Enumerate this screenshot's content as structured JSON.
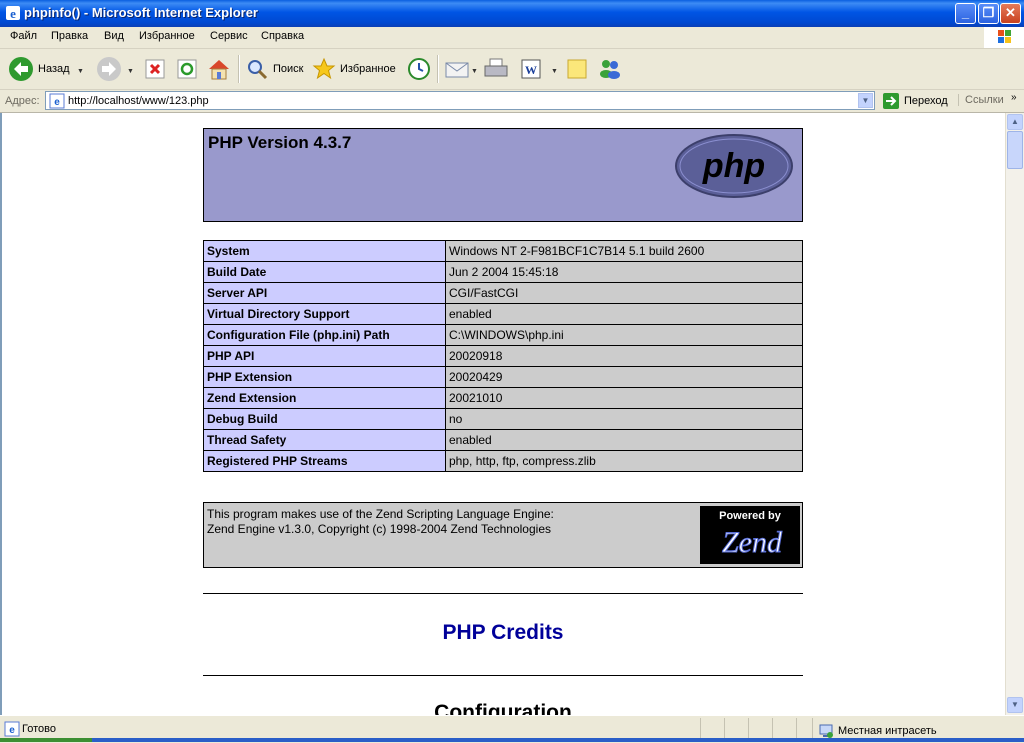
{
  "window": {
    "title": "phpinfo() - Microsoft Internet Explorer"
  },
  "menu": [
    "Файл",
    "Правка",
    "Вид",
    "Избранное",
    "Сервис",
    "Справка"
  ],
  "toolbar": {
    "back_label": "Назад",
    "search_label": "Поиск",
    "favorites_label": "Избранное"
  },
  "address": {
    "label": "Адрес:",
    "url": "http://localhost/www/123.php",
    "go_label": "Переход",
    "links_label": "Ссылки"
  },
  "page": {
    "header_title": "PHP Version 4.3.7",
    "info_rows": [
      {
        "key": "System",
        "value": "Windows NT 2-F981BCF1C7B14 5.1 build 2600"
      },
      {
        "key": "Build Date",
        "value": "Jun 2 2004 15:45:18"
      },
      {
        "key": "Server API",
        "value": "CGI/FastCGI"
      },
      {
        "key": "Virtual Directory Support",
        "value": "enabled"
      },
      {
        "key": "Configuration File (php.ini) Path",
        "value": "C:\\WINDOWS\\php.ini"
      },
      {
        "key": "PHP API",
        "value": "20020918"
      },
      {
        "key": "PHP Extension",
        "value": "20020429"
      },
      {
        "key": "Zend Extension",
        "value": "20021010"
      },
      {
        "key": "Debug Build",
        "value": "no"
      },
      {
        "key": "Thread Safety",
        "value": "enabled"
      },
      {
        "key": "Registered PHP Streams",
        "value": "php, http, ftp, compress.zlib"
      }
    ],
    "zend_line1": "This program makes use of the Zend Scripting Language Engine:",
    "zend_line2": "Zend Engine v1.3.0, Copyright (c) 1998-2004 Zend Technologies",
    "zend_logo_text": "Powered by",
    "zend_logo_word": "Zend",
    "php_logo_text": "php",
    "credits_heading": "PHP Credits",
    "config_heading": "Configuration"
  },
  "status": {
    "text": "Готово",
    "zone": "Местная интрасеть"
  },
  "colors": {
    "header_bg": "#9999cc",
    "key_bg": "#ccccff",
    "value_bg": "#cccccc",
    "credits": "#000099"
  }
}
